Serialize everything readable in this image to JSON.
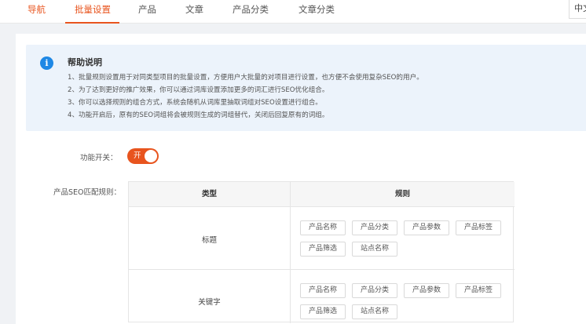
{
  "nav": {
    "tabs": [
      "导航",
      "批量设置",
      "产品",
      "文章",
      "产品分类",
      "文章分类"
    ],
    "active_index": 1,
    "language": "中文"
  },
  "help": {
    "title": "帮助说明",
    "lines": [
      "1、批量规则设置用于对同类型项目的批量设置，方便用户大批量的对项目进行设置，也方便不会使用复杂SEO的用户。",
      "2、为了达到更好的推广效果，你可以通过词库设置添加更多的词汇进行SEO优化组合。",
      "3、你可以选择规则的组合方式，系统会随机从词库里抽取词组对SEO设置进行组合。",
      "4、功能开启后，原有的SEO词组将会被规则生成的词组替代，关闭后回复原有的词组。"
    ]
  },
  "feature_switch": {
    "label": "功能开关：",
    "state_text": "开",
    "on": true
  },
  "rules": {
    "label": "产品SEO匹配规则：",
    "headers": {
      "type": "类型",
      "rule": "规则"
    },
    "rows": [
      {
        "type": "标题",
        "tags": [
          "产品名称",
          "产品分类",
          "产品参数",
          "产品标签",
          "产品筛选",
          "站点名称"
        ]
      },
      {
        "type": "关键字",
        "tags": [
          "产品名称",
          "产品分类",
          "产品参数",
          "产品标签",
          "产品筛选",
          "站点名称"
        ]
      }
    ]
  },
  "colors": {
    "accent": "#e8541e",
    "info": "#1e88e5",
    "help_bg": "#ecf3fb"
  }
}
